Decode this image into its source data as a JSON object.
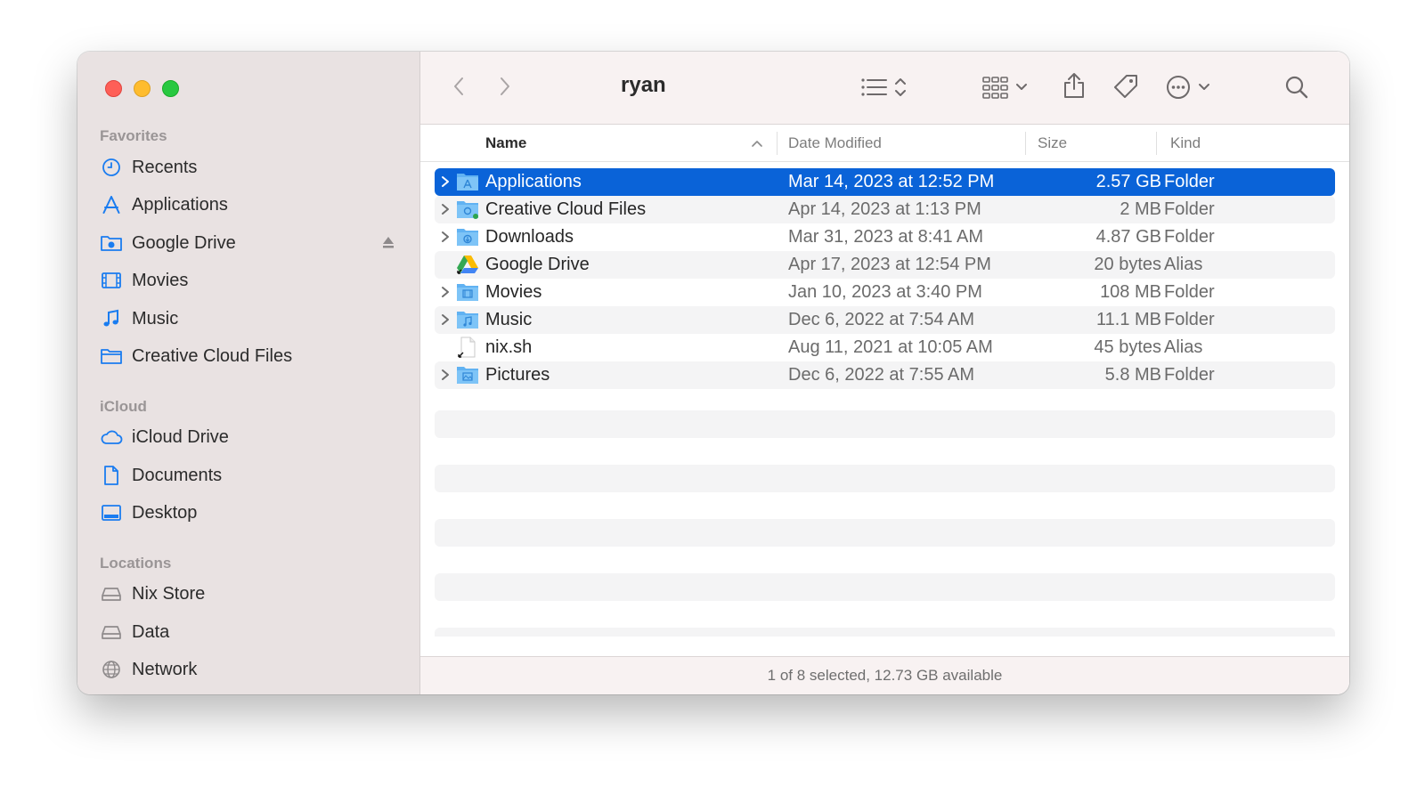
{
  "window": {
    "title": "ryan",
    "status": "1 of 8 selected, 12.73 GB available"
  },
  "colors": {
    "selection": "#0a63d8",
    "sidebar_bg": "#e9e2e2",
    "accent_icon": "#1a7cf0"
  },
  "sidebar": {
    "favorites_title": "Favorites",
    "favorites": [
      {
        "label": "Recents",
        "icon": "clock-icon"
      },
      {
        "label": "Applications",
        "icon": "app-store-icon"
      },
      {
        "label": "Google Drive",
        "icon": "folder-badge-icon",
        "eject": true
      },
      {
        "label": "Movies",
        "icon": "film-icon"
      },
      {
        "label": "Music",
        "icon": "music-note-icon"
      },
      {
        "label": "Creative Cloud Files",
        "icon": "folder-icon"
      }
    ],
    "icloud_title": "iCloud",
    "icloud": [
      {
        "label": "iCloud Drive",
        "icon": "cloud-icon"
      },
      {
        "label": "Documents",
        "icon": "document-icon"
      },
      {
        "label": "Desktop",
        "icon": "desktop-icon"
      }
    ],
    "locations_title": "Locations",
    "locations": [
      {
        "label": "Nix Store",
        "icon": "drive-icon"
      },
      {
        "label": "Data",
        "icon": "drive-icon"
      },
      {
        "label": "Network",
        "icon": "globe-icon"
      }
    ]
  },
  "columns": {
    "name": "Name",
    "date": "Date Modified",
    "size": "Size",
    "kind": "Kind"
  },
  "files": [
    {
      "name": "Applications",
      "date": "Mar 14, 2023 at 12:52 PM",
      "size": "2.57 GB",
      "kind": "Folder",
      "icon": "applications-folder-icon",
      "expandable": true,
      "selected": true
    },
    {
      "name": "Creative Cloud Files",
      "date": "Apr 14, 2023 at 1:13 PM",
      "size": "2 MB",
      "kind": "Folder",
      "icon": "creative-cloud-folder-icon",
      "expandable": true
    },
    {
      "name": "Downloads",
      "date": "Mar 31, 2023 at 8:41 AM",
      "size": "4.87 GB",
      "kind": "Folder",
      "icon": "downloads-folder-icon",
      "expandable": true
    },
    {
      "name": "Google Drive",
      "date": "Apr 17, 2023 at 12:54 PM",
      "size": "20 bytes",
      "kind": "Alias",
      "icon": "google-drive-icon",
      "expandable": false
    },
    {
      "name": "Movies",
      "date": "Jan 10, 2023 at 3:40 PM",
      "size": "108 MB",
      "kind": "Folder",
      "icon": "movies-folder-icon",
      "expandable": true
    },
    {
      "name": "Music",
      "date": "Dec 6, 2022 at 7:54 AM",
      "size": "11.1 MB",
      "kind": "Folder",
      "icon": "music-folder-icon",
      "expandable": true
    },
    {
      "name": "nix.sh",
      "date": "Aug 11, 2021 at 10:05 AM",
      "size": "45 bytes",
      "kind": "Alias",
      "icon": "file-alias-icon",
      "expandable": false
    },
    {
      "name": "Pictures",
      "date": "Dec 6, 2022 at 7:55 AM",
      "size": "5.8 MB",
      "kind": "Folder",
      "icon": "pictures-folder-icon",
      "expandable": true
    }
  ]
}
